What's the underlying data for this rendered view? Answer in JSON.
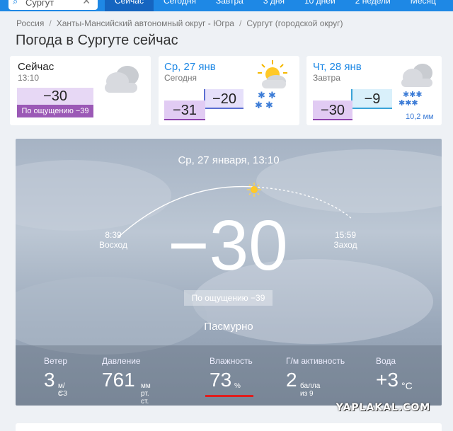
{
  "nav": {
    "search_value": "Сургут",
    "tabs": [
      {
        "label": "Сейчас"
      },
      {
        "label": "Сегодня"
      },
      {
        "label": "Завтра"
      },
      {
        "label": "3 дня"
      },
      {
        "label": "10 дней"
      },
      {
        "label": "2 недели"
      },
      {
        "label": "Месяц"
      }
    ]
  },
  "breadcrumbs": [
    "Россия",
    "Ханты-Мансийский автономный округ - Югра",
    "Сургут (городской округ)"
  ],
  "page_title": "Погода в Сургуте сейчас",
  "cards": {
    "now": {
      "label": "Сейчас",
      "time": "13:10",
      "temp": "−30",
      "feels": "По ощущению −39"
    },
    "today": {
      "date": "Ср, 27 янв",
      "label": "Сегодня",
      "min": "−31",
      "max": "−20"
    },
    "tomorrow": {
      "date": "Чт, 28 янв",
      "label": "Завтра",
      "min": "−30",
      "max": "−9",
      "precip": "10,2 мм"
    }
  },
  "hero": {
    "datetime": "Ср, 27 января, 13:10",
    "sunrise_time": "8:39",
    "sunrise_label": "Восход",
    "sunset_time": "15:59",
    "sunset_label": "Заход",
    "temp": "−30",
    "feels": "По ощущению −39",
    "condition": "Пасмурно",
    "stats": {
      "wind": {
        "label": "Ветер",
        "value": "3",
        "unit": "м/с",
        "dir": "СЗ"
      },
      "pressure": {
        "label": "Давление",
        "value": "761",
        "unit": "мм",
        "unit2": "рт. ст."
      },
      "humidity": {
        "label": "Влажность",
        "value": "73",
        "unit": "%"
      },
      "geomagnetic": {
        "label": "Г/м активность",
        "value": "2",
        "unit": "балла",
        "unit2": "из 9"
      },
      "water": {
        "label": "Вода",
        "value": "+3",
        "unit": "°C"
      }
    }
  },
  "watermark": "YAPLAKAL.COM",
  "colors": {
    "nav": "#1e88e5",
    "accent": "#9b59b6",
    "highlight": "#e01d1d"
  }
}
